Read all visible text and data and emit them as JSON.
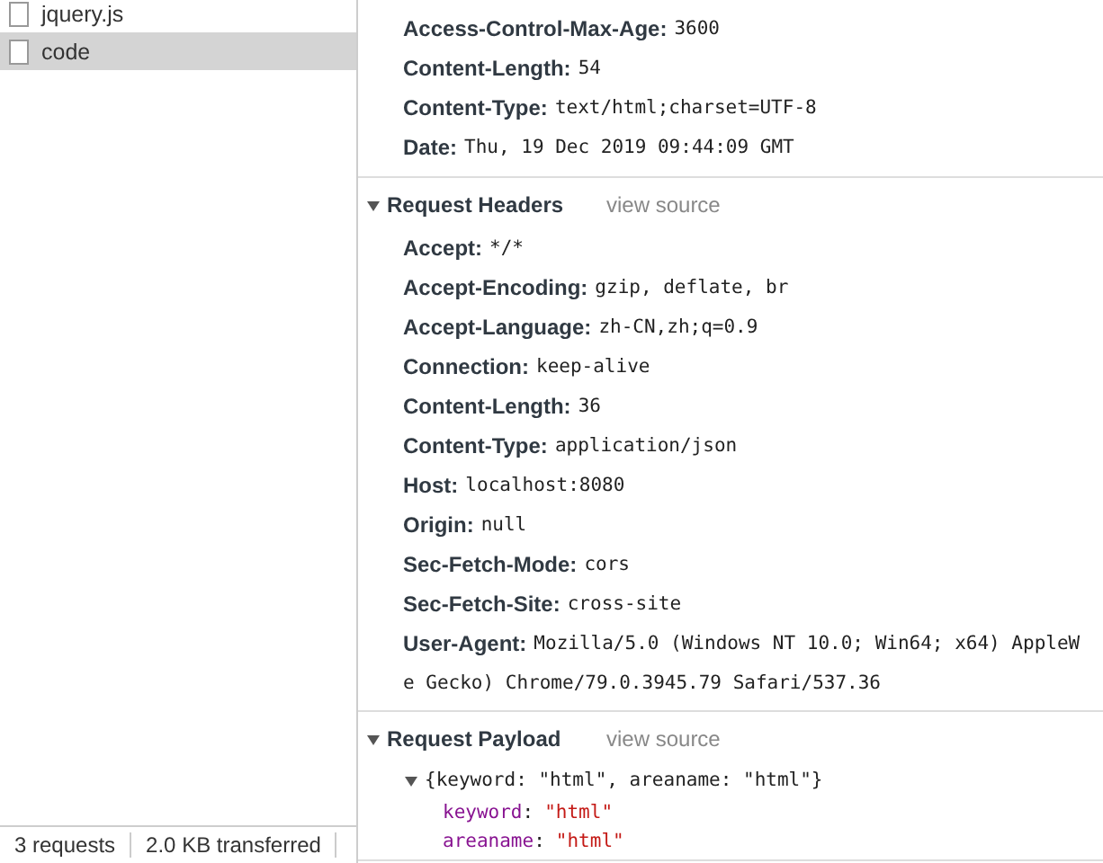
{
  "sidebar": {
    "items": [
      {
        "name": "jquery.js",
        "selected": false
      },
      {
        "name": "code",
        "selected": true
      }
    ]
  },
  "status_bar": {
    "requests": "3 requests",
    "transferred": "2.0 KB transferred"
  },
  "response_headers": {
    "rows": [
      {
        "name": "Access-Control-Max-Age:",
        "value": "3600"
      },
      {
        "name": "Content-Length:",
        "value": "54"
      },
      {
        "name": "Content-Type:",
        "value": "text/html;charset=UTF-8"
      },
      {
        "name": "Date:",
        "value": "Thu, 19 Dec 2019 09:44:09 GMT"
      }
    ]
  },
  "request_headers": {
    "title": "Request Headers",
    "view_source": "view source",
    "expanded": true,
    "rows": [
      {
        "name": "Accept:",
        "value": "*/*"
      },
      {
        "name": "Accept-Encoding:",
        "value": "gzip, deflate, br"
      },
      {
        "name": "Accept-Language:",
        "value": "zh-CN,zh;q=0.9"
      },
      {
        "name": "Connection:",
        "value": "keep-alive"
      },
      {
        "name": "Content-Length:",
        "value": "36"
      },
      {
        "name": "Content-Type:",
        "value": "application/json"
      },
      {
        "name": "Host:",
        "value": "localhost:8080"
      },
      {
        "name": "Origin:",
        "value": "null"
      },
      {
        "name": "Sec-Fetch-Mode:",
        "value": "cors"
      },
      {
        "name": "Sec-Fetch-Site:",
        "value": "cross-site"
      },
      {
        "name": "User-Agent:",
        "value": "Mozilla/5.0 (Windows NT 10.0; Win64; x64) AppleW",
        "continuation": "e Gecko) Chrome/79.0.3945.79 Safari/537.36"
      }
    ]
  },
  "request_payload": {
    "title": "Request Payload",
    "view_source": "view source",
    "expanded": true,
    "summary": "{keyword: \"html\", areaname: \"html\"}",
    "summary_expanded": true,
    "properties": [
      {
        "key": "keyword",
        "separator": ":",
        "value": "\"html\""
      },
      {
        "key": "areaname",
        "separator": ":",
        "value": "\"html\""
      }
    ]
  }
}
